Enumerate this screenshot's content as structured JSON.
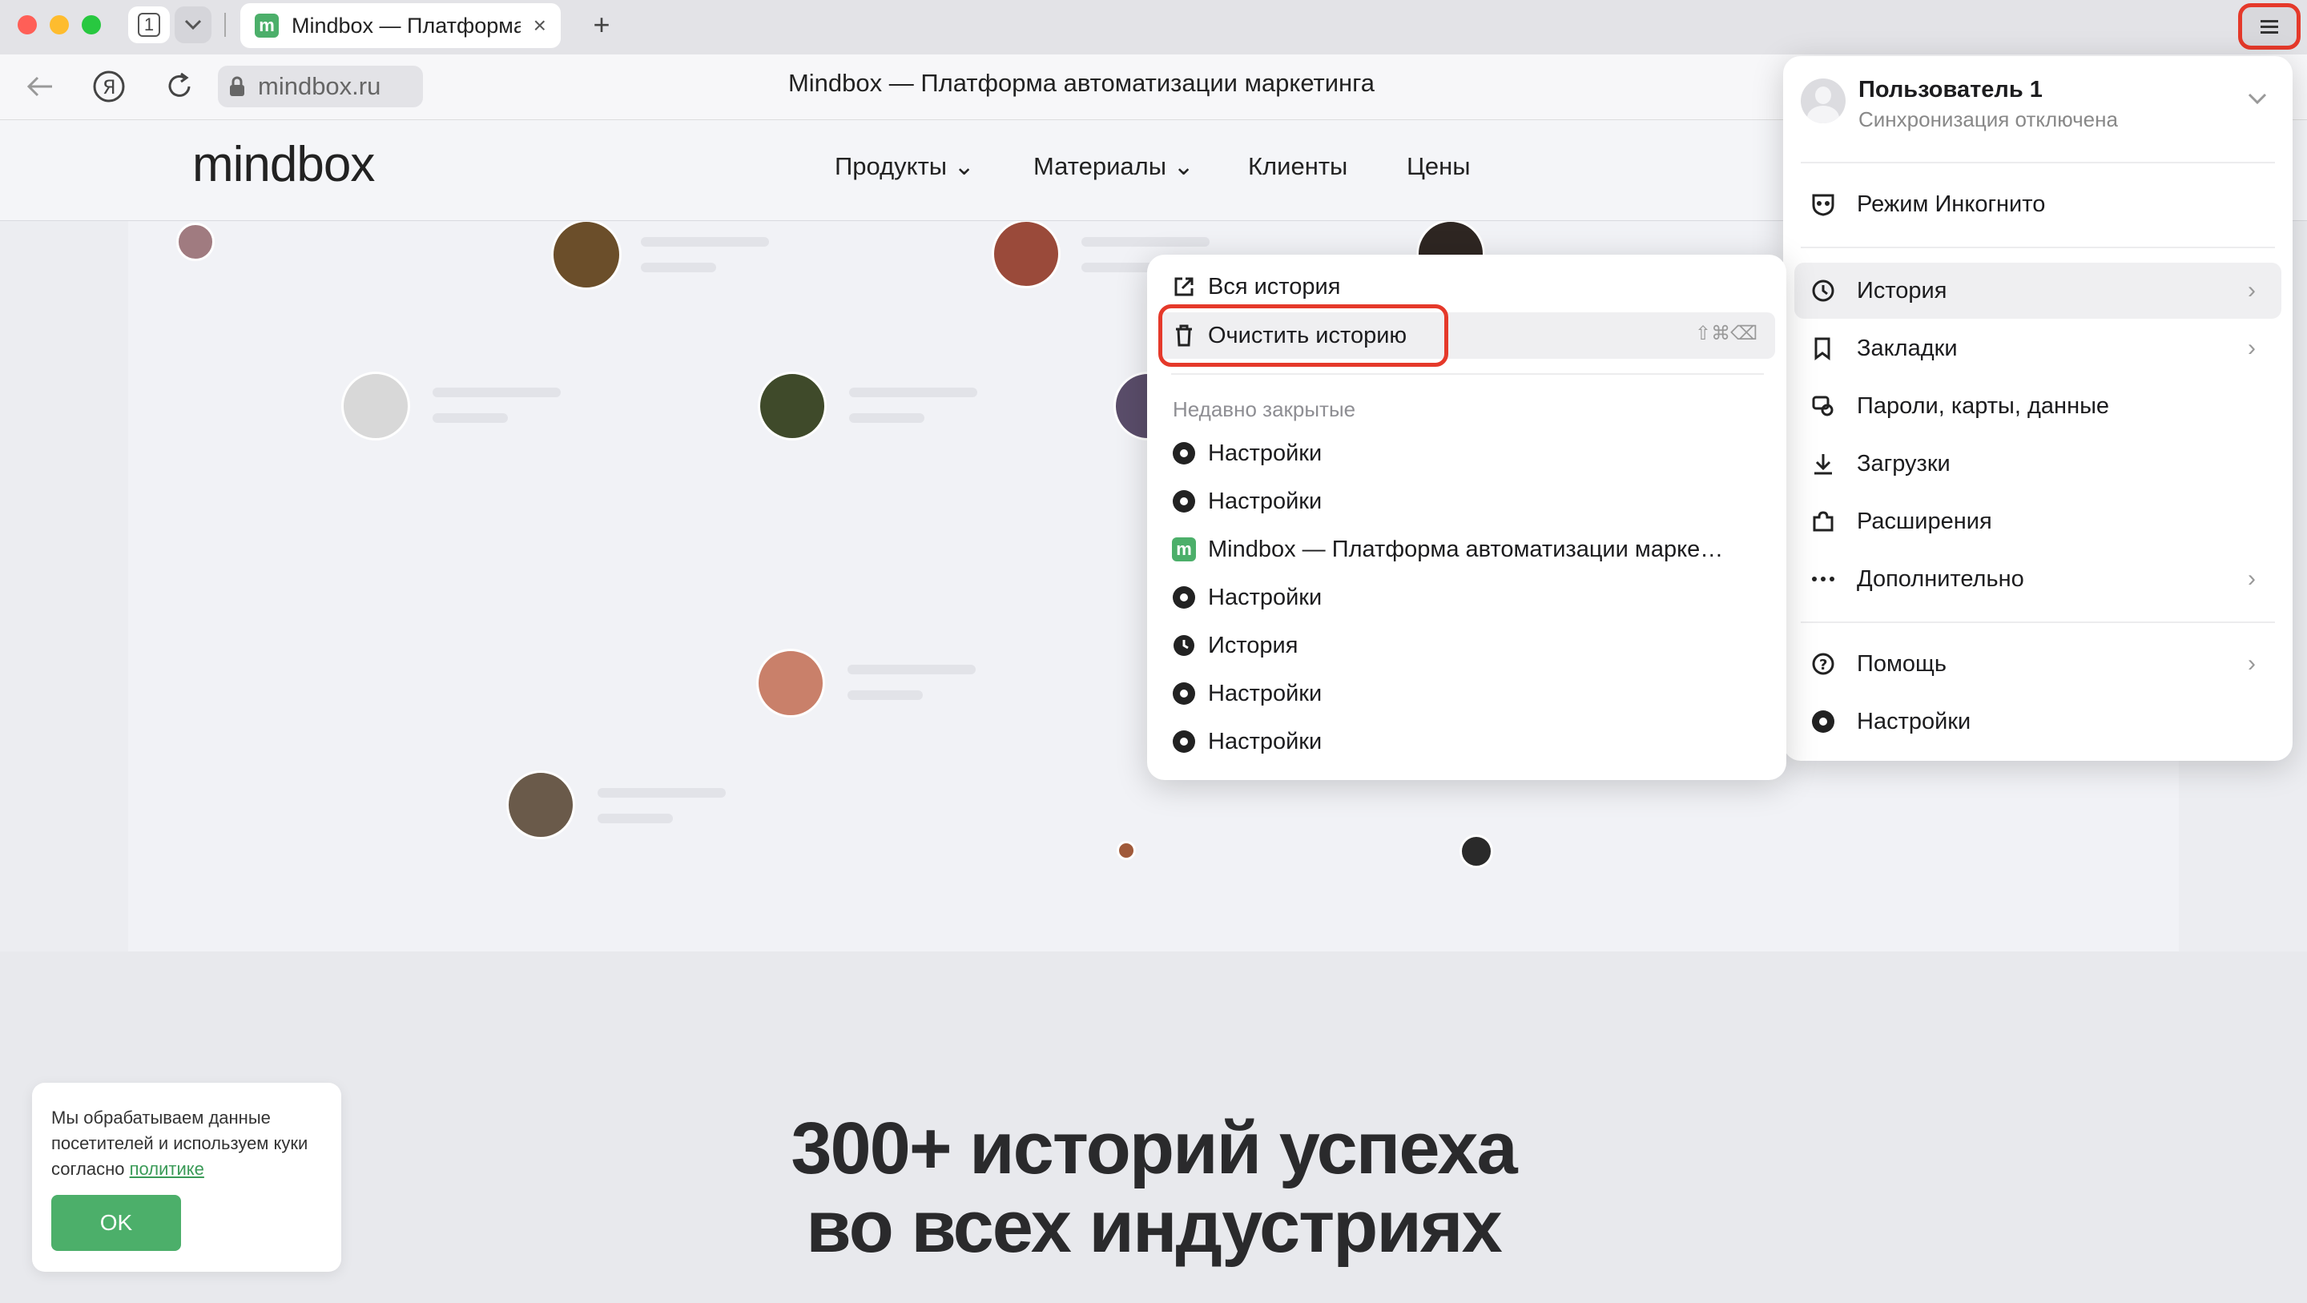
{
  "browser": {
    "tab_count": "1",
    "tab_title": "Mindbox — Платформа автоматизации маркетинга",
    "tab_favicon": "m",
    "new_tab": "+",
    "close_tab": "×",
    "url": "mindbox.ru",
    "page_title": "Mindbox — Платформа автоматизации маркетинга",
    "icons": [
      "back-icon",
      "yandex-icon",
      "reload-icon",
      "lock-icon",
      "menu-icon"
    ]
  },
  "site": {
    "logo": "mindbox",
    "nav": [
      "Продукты ⌄",
      "Материалы ⌄",
      "Клиенты",
      "Цены"
    ],
    "headline_line1": "300+ историй успеха",
    "headline_line2": "во всех индустриях",
    "cookie_text": "Мы обрабатываем данные посетителей и используем куки согласно ",
    "cookie_link": "политике",
    "cookie_ok": "OK"
  },
  "main_menu": {
    "profile_name": "Пользователь 1",
    "profile_status": "Синхронизация отключена",
    "incognito": "Режим Инкогнито",
    "history": "История",
    "bookmarks": "Закладки",
    "passwords": "Пароли, карты, данные",
    "downloads": "Загрузки",
    "extensions": "Расширения",
    "more": "Дополнительно",
    "help": "Помощь",
    "settings": "Настройки"
  },
  "history_menu": {
    "all_history": "Вся история",
    "clear_history": "Очистить историю",
    "clear_shortcut": "⇧⌘⌫",
    "recent_header": "Недавно закрытые",
    "recent": [
      {
        "label": "Настройки",
        "icon": "gear-icon"
      },
      {
        "label": "Настройки",
        "icon": "gear-icon"
      },
      {
        "label": "Mindbox — Платформа автоматизации марке…",
        "icon": "mindbox-favicon"
      },
      {
        "label": "Настройки",
        "icon": "gear-icon"
      },
      {
        "label": "История",
        "icon": "clock-icon"
      },
      {
        "label": "Настройки",
        "icon": "gear-icon"
      },
      {
        "label": "Настройки",
        "icon": "gear-icon"
      }
    ]
  },
  "colors": {
    "highlight": "#e5392a",
    "accent_green": "#4caf6a"
  }
}
